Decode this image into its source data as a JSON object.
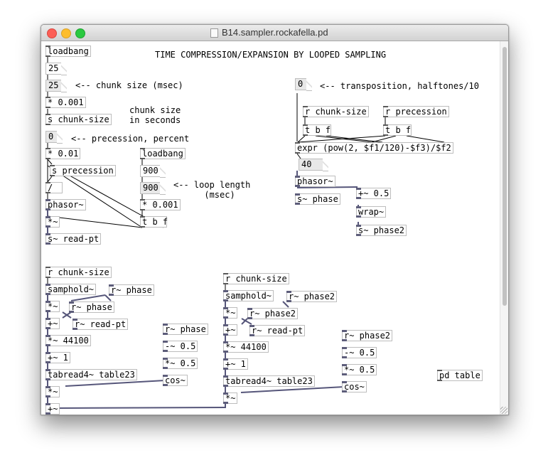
{
  "window": {
    "title": "B14.sampler.rockafella.pd"
  },
  "objects": {
    "loadbang1": "loadbang",
    "num25a": "25",
    "num25b": "25",
    "mul001a": "* 0.001",
    "s_chunk": "s chunk-size",
    "num0a": "0",
    "mul01": "* 0.01",
    "s_prec": "s precession",
    "div": "/",
    "phasor1": "phasor~",
    "mul_sig1": "*~",
    "s_readpt": "s~ read-pt",
    "loadbang2": "loadbang",
    "num900a": "900",
    "num900b": "900",
    "mul001b": "* 0.001",
    "tbf1": "t b f",
    "num0b": "0",
    "r_chunk1": "r chunk-size",
    "r_prec": "r precession",
    "tbf2": "t b f",
    "tbf3": "t b f",
    "expr": "expr (pow(2, $f1/120)-$f3)/$f2",
    "num40": "40",
    "phasor2": "phasor~",
    "s_phase": "s~ phase",
    "add05": "+~ 0.5",
    "wrap": "wrap~",
    "s_phase2": "s~ phase2",
    "r_chunk2": "r chunk-size",
    "samphold1": "samphold~",
    "r_phase1": "r~ phase",
    "mul_sig2": "*~",
    "r_phase1b": "r~ phase",
    "add_sig1": "+~",
    "r_readpt1": "r~ read-pt",
    "mul44100a": "*~ 44100",
    "add1a": "+~ 1",
    "tabread1": "tabread4~ table23",
    "mul_sig3": "*~",
    "add_sig_out": "+~",
    "r_phase_c": "r~ phase",
    "sub05a": "-~ 0.5",
    "mul05a": "*~ 0.5",
    "cos1": "cos~",
    "r_chunk3": "r chunk-size",
    "samphold2": "samphold~",
    "r_phase2a": "r~ phase2",
    "mul_sig4": "*~",
    "r_phase2b": "r~ phase2",
    "add_sig2": "+~",
    "r_readpt2": "r~ read-pt",
    "mul44100b": "*~ 44100",
    "add1b": "+~ 1",
    "tabread2": "tabread4~ table23",
    "mul_sig5": "*~",
    "r_phase2c": "r~ phase2",
    "sub05b": "-~ 0.5",
    "mul05b": "*~ 0.5",
    "cos2": "cos~",
    "pd_table": "pd table"
  },
  "comments": {
    "title": "TIME COMPRESSION/EXPANSION BY LOOPED SAMPLING",
    "chunk_size_msec": "<-- chunk size (msec)",
    "chunk_size_seconds": "chunk size\nin seconds",
    "precession_percent": "<-- precession, percent",
    "loop_length": "<-- loop length\n      (msec)",
    "transposition": "<-- transposition, halftones/10"
  }
}
